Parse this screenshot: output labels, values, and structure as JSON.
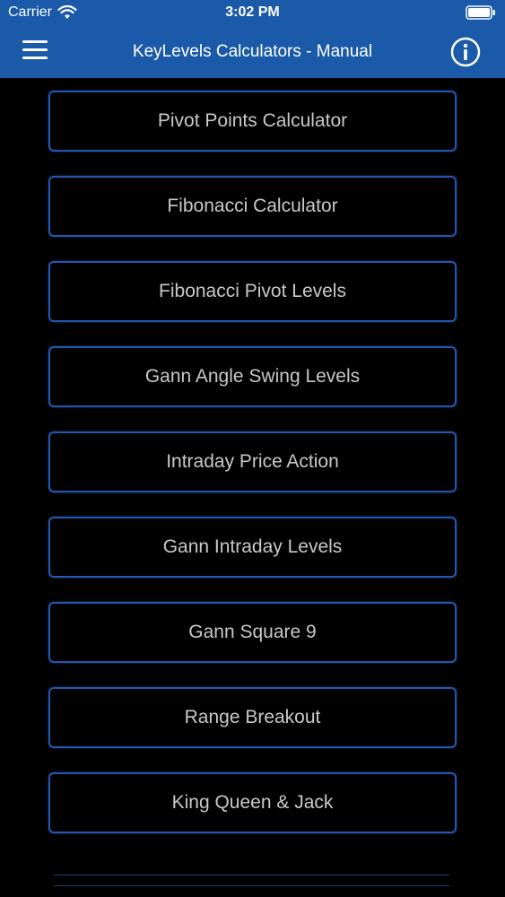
{
  "status_bar": {
    "carrier": "Carrier",
    "time": "3:02 PM",
    "wifi_icon": "wifi-icon",
    "battery_icon": "battery-icon"
  },
  "nav": {
    "title": "KeyLevels Calculators - Manual",
    "menu_icon": "hamburger-menu-icon",
    "info_icon": "info-icon"
  },
  "colors": {
    "header_bg": "#1a5aa8",
    "page_bg": "#000000",
    "button_border": "#2458b0",
    "button_text": "#c8c8c8"
  },
  "calculators": [
    {
      "label": "Pivot Points Calculator"
    },
    {
      "label": "Fibonacci Calculator"
    },
    {
      "label": "Fibonacci Pivot Levels"
    },
    {
      "label": "Gann Angle Swing Levels"
    },
    {
      "label": "Intraday Price Action"
    },
    {
      "label": "Gann Intraday Levels"
    },
    {
      "label": "Gann Square 9"
    },
    {
      "label": "Range Breakout"
    },
    {
      "label": "King Queen & Jack"
    }
  ]
}
